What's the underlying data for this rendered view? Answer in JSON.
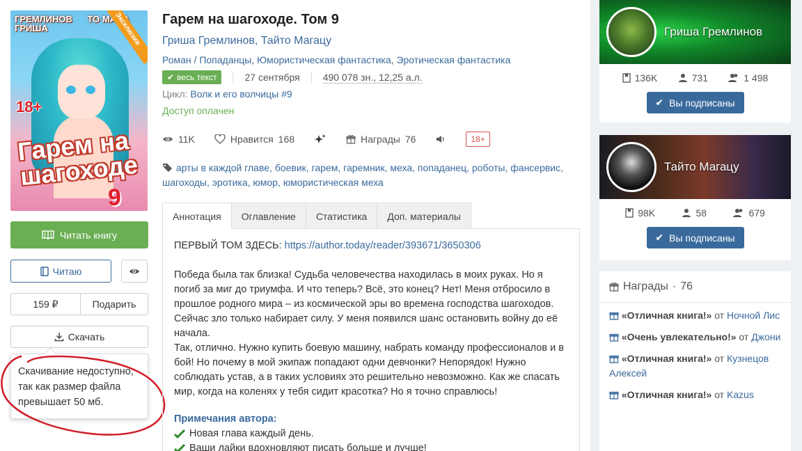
{
  "book": {
    "title": "Гарем на шагоходе. Том 9",
    "authors": [
      "Гриша Гремлинов",
      "Тайто Магацу"
    ],
    "author_sep": ", ",
    "genres": [
      "Роман / Попаданцы",
      "Юмористическая фантастика",
      "Эротическая фантастика"
    ],
    "badge_full": "весь текст",
    "date": "27 сентября",
    "size": "490 078 зн., 12,25 а.л.",
    "series_label": "Цикл:",
    "series_name": "Волк и его волчицы",
    "series_num": "#9",
    "access": "Доступ оплачен",
    "views": "11K",
    "likes_label": "Нравится",
    "likes": "168",
    "awards_label": "Награды",
    "awards": "76",
    "age": "18+",
    "tags": [
      "арты в каждой главе",
      "боевик",
      "гарем",
      "гаремник",
      "меха",
      "попаданец",
      "роботы",
      "фансервис",
      "шагоходы",
      "эротика",
      "юмор",
      "юмористическая меха"
    ]
  },
  "cover": {
    "authors_left": "Гремлинов Гриша",
    "authors_right": "то Маца",
    "exclusive": "Эксклюзив",
    "age": "18+",
    "title": "Гарем на шагоходе",
    "volume": "9"
  },
  "actions": {
    "read_label": "Читать книгу",
    "reading_label": "Читаю",
    "price": "159 ₽",
    "gift_label": "Подарить",
    "download_label": "Скачать",
    "download_tooltip": "Скачивание недоступно, так как размер файла превышает 50 мб."
  },
  "tabs": [
    "Аннотация",
    "Оглавление",
    "Статистика",
    "Доп. материалы"
  ],
  "annotation": {
    "first_volume_label": "ПЕРВЫЙ ТОМ ЗДЕСЬ:",
    "first_volume_link": "https://author.today/reader/393671/3650306",
    "para1": "Победа была так близка! Судьба человечества находилась в моих руках. Но я погиб за миг до триумфа. И что теперь? Всё, это конец? Нет! Меня отбросило в прошлое родного мира – из космической эры во времена господства шагоходов. Сейчас зло только набирает силу. У меня появился шанс остановить войну до её начала.",
    "para2": "Так, отлично. Нужно купить боевую машину, набрать команду профессионалов и в бой! Но почему в мой экипаж попадают одни девчонки? Непорядок! Нужно соблюдать устав, а в таких условиях это решительно невозможно. Как же спасать мир, когда на коленях у тебя сидит красотка? Но я точно справлюсь!",
    "notes_title": "Примечания автора:",
    "notes": [
      "Новая глава каждый день.",
      "Ваши лайки вдохновляют писать больше и лучше!"
    ]
  },
  "author_cards": [
    {
      "name": "Гриша Гремлинов",
      "books": "136K",
      "followers": "731",
      "subscribers": "1 498",
      "button": "Вы подписаны"
    },
    {
      "name": "Тайто Магацу",
      "books": "98K",
      "followers": "58",
      "subscribers": "679",
      "button": "Вы подписаны"
    }
  ],
  "awards_box": {
    "title": "Награды",
    "dot": "·",
    "count": "76",
    "from": "от",
    "items": [
      {
        "award": "«Отличная книга!»",
        "user": "Ночной Лис"
      },
      {
        "award": "«Очень увлекательно!»",
        "user": "Джони"
      },
      {
        "award": "«Отличная книга!»",
        "user": "Кузнецов Алексей"
      },
      {
        "award": "«Отличная книга!»",
        "user": "Kazus"
      }
    ]
  },
  "colors": {
    "green": "#6aaf54",
    "blue": "#3a6a9c",
    "red": "#d9534f",
    "annotation_red": "#d0202a"
  }
}
